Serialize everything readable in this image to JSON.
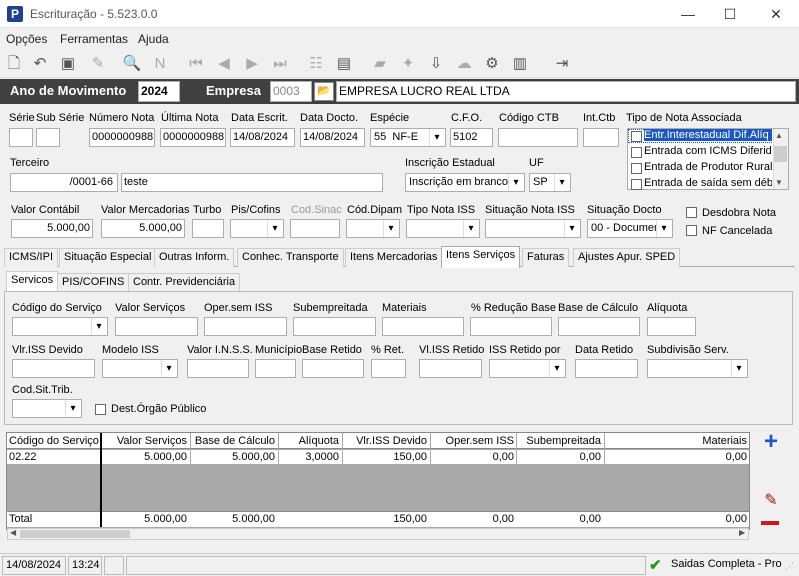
{
  "window": {
    "title": "Escrituração - 5.523.0.0",
    "app_icon": "P"
  },
  "menu": [
    "Opções",
    "Ferramentas",
    "Ajuda"
  ],
  "header": {
    "ano_label": "Ano de Movimento",
    "ano_value": "2024",
    "empresa_label": "Empresa",
    "empresa_code": "0003",
    "empresa_name": "EMPRESA LUCRO REAL LTDA"
  },
  "row1": {
    "serie_label": "Série",
    "subserie_label": "Sub Série",
    "numero_nota_label": "Número Nota",
    "numero_nota": "0000000988",
    "ultima_nota_label": "Última Nota",
    "ultima_nota": "0000000988",
    "data_escrit_label": "Data Escrit.",
    "data_escrit": "14/08/2024",
    "data_docto_label": "Data Docto.",
    "data_docto": "14/08/2024",
    "especie_label": "Espécie",
    "especie_code": "55",
    "especie_value": "NF-E",
    "cfo_label": "C.F.O.",
    "cfo_value": "5102",
    "codigo_ctb_label": "Código CTB",
    "int_ctb_label": "Int.Ctb",
    "tipo_nota_label": "Tipo de Nota Associada",
    "tipo_nota_items": [
      "Entr.Interestadual Dif.Alíq",
      "Entrada com ICMS Diferido",
      "Entrada de Produtor Rural",
      "Entrada de saída sem débi"
    ]
  },
  "row2": {
    "terceiro_label": "Terceiro",
    "terceiro_cnpj": "/0001-66",
    "terceiro_name": "teste",
    "inscricao_label": "Inscrição Estadual",
    "inscricao_value": "Inscrição em branco",
    "uf_label": "UF",
    "uf_value": "SP"
  },
  "row3": {
    "valor_contabil_label": "Valor Contábil",
    "valor_contabil": "5.000,00",
    "valor_merc_label": "Valor Mercadorias",
    "valor_merc": "5.000,00",
    "turbo_label": "Turbo",
    "pis_label": "Pis/Cofins",
    "cod_sinac_label": "Cod.Sinac",
    "cod_dipam_label": "Cód.Dipam",
    "tipo_iss_label": "Tipo Nota ISS",
    "sit_iss_label": "Situação Nota ISS",
    "sit_docto_label": "Situação Docto",
    "sit_docto_value": "00 - Documen",
    "desdobra_label": "Desdobra Nota",
    "nf_cancelada_label": "NF Cancelada"
  },
  "tabs": [
    "ICMS/IPI",
    "Situação Especial",
    "Outras Inform.",
    "Conhec. Transporte",
    "Itens Mercadorias",
    "Itens Serviços",
    "Faturas",
    "Ajustes Apur. SPED"
  ],
  "subtabs": [
    "Servicos",
    "PIS/COFINS",
    "Contr. Previdenciária"
  ],
  "form": {
    "codigo_servico": "Código do Serviço",
    "valor_servicos": "Valor Serviços",
    "oper_sem_iss": "Oper.sem ISS",
    "subempreitada": "Subempreitada",
    "materiais": "Materiais",
    "perc_reducao": "% Redução Base",
    "base_calculo": "Base de Cálculo",
    "aliquota": "Alíquota",
    "vlr_iss_devido": "Vlr.ISS Devido",
    "modelo_iss": "Modelo ISS",
    "valor_inss": "Valor I.N.S.S.",
    "municipio": "Município",
    "base_retido": "Base Retido",
    "perc_ret": "% Ret.",
    "vl_iss_retido": "Vl.ISS Retido",
    "iss_retido_por": "ISS Retido por",
    "data_retido": "Data Retido",
    "subdivisao": "Subdivisão Serv.",
    "cod_sit_trib": "Cod.Sit.Trib.",
    "dest_orgao": "Dest.Órgão Público"
  },
  "grid": {
    "headers": [
      "Código do Serviço",
      "Valor Serviços",
      "Base de Cálculo",
      "Alíquota",
      "Vlr.ISS Devido",
      "Oper.sem ISS",
      "Subempreitada",
      "Materiais"
    ],
    "row": [
      "02.22",
      "5.000,00",
      "5.000,00",
      "3,0000",
      "150,00",
      "0,00",
      "0,00",
      "0,00"
    ],
    "total": [
      "Total",
      "5.000,00",
      "5.000,00",
      "",
      "150,00",
      "0,00",
      "0,00",
      "0,00"
    ]
  },
  "status": {
    "date": "14/08/2024",
    "time": "13:24",
    "mode": "Saidas Completa - Pros"
  },
  "colors": {
    "header_bar": "#404040",
    "yellow": "#ffffe1",
    "green": "#ddffdd",
    "add": "#1a56c4",
    "remove": "#d01818"
  }
}
